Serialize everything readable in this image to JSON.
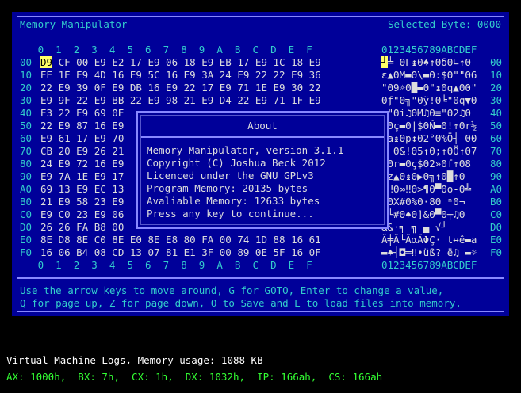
{
  "app": {
    "title": "Memory Manipulator",
    "selected_byte": "Selected Byte: 0000"
  },
  "grid": {
    "hex_header": "0  1  2  3  4  5  6  7  8  9  A  B  C  D  E  F",
    "ascii_header": "0123456789ABCDEF",
    "rows": [
      {
        "addr": "00",
        "cursor": "D9",
        "bytes": " CF 00 E9 E2 17 E9 06 18 E9 EB 17 E9 1C 18 E9",
        "ascii_cursor": "┘",
        "ascii": "╧ ΘΓ↨Θ♠↑ΘδΘ∟↑Θ"
      },
      {
        "addr": "10",
        "bytes": "EE 1E E9 4D 16 E9 5C 16 E9 3A 24 E9 22 22 E9 36",
        "ascii": "ε▲ΘM▬Θ\\▬Θ:$Θ\"\"Θ6"
      },
      {
        "addr": "20",
        "bytes": "22 E9 39 0F E9 DB 16 E9 22 17 E9 71 1E E9 30 22",
        "ascii": "\"Θ9☼Θ█▬Θ\"↨Θq▲Θ0\""
      },
      {
        "addr": "30",
        "bytes": "E9 9F 22 E9 BB 22 E9 98 21 E9 D4 22 E9 71 1F E9",
        "ascii": "Θƒ\"Θ╗\"Θÿ!Θ╘\"Θq▼Θ"
      },
      {
        "addr": "40",
        "bytes": "E3 22 E9 69 0E",
        "ascii": "π\"Θi♫ΘM♫Θ≡\"Θ2♫Θ"
      },
      {
        "addr": "50",
        "bytes": "22 E9 87 16 E9",
        "ascii": "\"Θç▬Θ|$ΘÑ▬Θ!↑Θr½"
      },
      {
        "addr": "60",
        "bytes": "E9 61 17 E9 70",
        "ascii": "Θa↨Θp↕Θ2°Θ%Ö┤ Θ0"
      },
      {
        "addr": "70",
        "bytes": "CB 20 E9 26 21",
        "ascii": "╦ Θ&!Θ5↑Θ;↑ΘÖ↑Θ7"
      },
      {
        "addr": "80",
        "bytes": "24 E9 72 16 E9",
        "ascii": "$Θr▬Θç$Θ2»Θf↑Θ8"
      },
      {
        "addr": "90",
        "bytes": "E9 7A 1E E9 17",
        "ascii": "Θz▲Θ↨Θ▶Θ╗↑Θ█↑Θ"
      },
      {
        "addr": "A0",
        "bytes": "69 13 E9 EC 13",
        "ascii": "i‼Θ∞‼Θ>¶Θ▀Θo-Θ╩"
      },
      {
        "addr": "B0",
        "bytes": "21 E9 58 23 E9",
        "ascii": "!ΘX#Θ%Θ·8Θ ⁿΘ¬"
      },
      {
        "addr": "C0",
        "bytes": "E9 C0 23 E9 06",
        "ascii": "Θ└#Θ♠Θ]&Θ▀Θ┬♫Θ"
      },
      {
        "addr": "D0",
        "bytes": "26 26 FA B8 00",
        "ascii": "&&·╕ ╗ ▄ √┘"
      },
      {
        "addr": "E0",
        "bytes": "8E D8 8E C0 8E E0 8E E8 80 FA 00 74 1D 88 16 61",
        "ascii": "Ä╪Ä└ÄαÄΦÇ· t↔ê▬a"
      },
      {
        "addr": "F0",
        "bytes": "16 06 B4 08 CD 13 07 81 E1 3F 00 89 0E 5F 16 0F",
        "ascii": "▬♠┤◘═‼•üß? ë♫_▬☼"
      }
    ]
  },
  "help": {
    "line1": "Use the arrow keys to move around, G for GOTO, Enter to change a value,",
    "line2": "Q for page up, Z for page down, O to Save and L to load files into memory."
  },
  "about": {
    "title": "About",
    "lines": [
      "Memory Manipulator, version 3.1.1",
      "Copyright (C) Joshua Beck 2012",
      "Licenced under the GNU GPLv3",
      "Program Memory: 20135 bytes",
      "Avaliable Memory: 12633 bytes",
      "Press any key to continue..."
    ]
  },
  "vm": {
    "title": "Virtual Machine Logs, Memory usage: 1088 KB",
    "registers": "AX: 1000h,  BX: 7h,  CX: 1h,  DX: 1032h,  IP: 166ah,  CS: 166ah"
  }
}
